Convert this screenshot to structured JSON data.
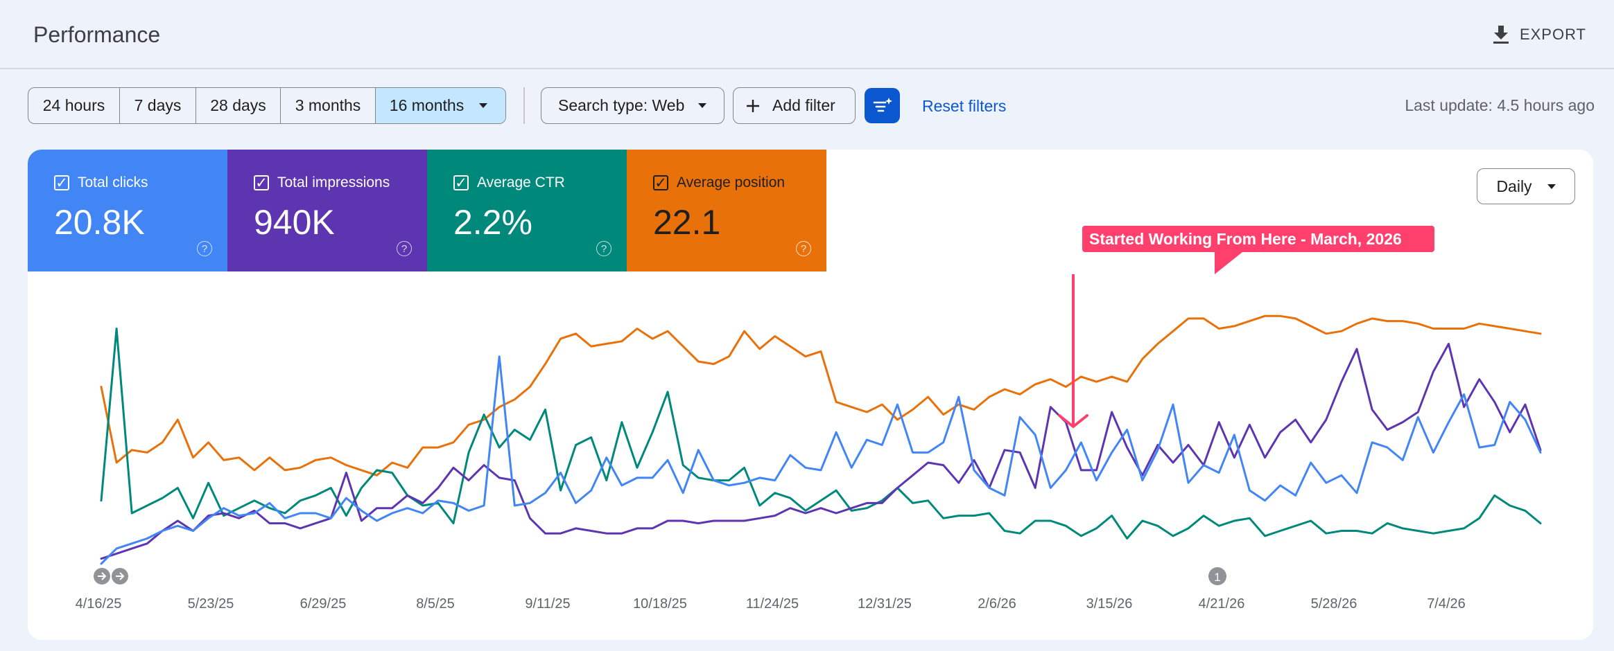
{
  "header": {
    "title": "Performance",
    "export_label": "EXPORT",
    "export_icon": "download-icon"
  },
  "date_range": {
    "options": [
      "24 hours",
      "7 days",
      "28 days",
      "3 months",
      "16 months"
    ],
    "selected": "16 months"
  },
  "filters": {
    "search_type": "Search type: Web",
    "add_filter": "Add filter",
    "reset": "Reset filters",
    "last_update": "Last update: 4.5 hours ago"
  },
  "metrics": [
    {
      "label": "Total clicks",
      "value": "20.8K",
      "color": "#4285f4",
      "text_color": "#ffffff"
    },
    {
      "label": "Total impressions",
      "value": "940K",
      "color": "#5e35b1",
      "text_color": "#ffffff"
    },
    {
      "label": "Average CTR",
      "value": "2.2%",
      "color": "#00897b",
      "text_color": "#ffffff"
    },
    {
      "label": "Average position",
      "value": "22.1",
      "color": "#e8710a",
      "text_color": "#1f1f1f"
    }
  ],
  "granularity": "Daily",
  "annotation": {
    "text": "Started Working From Here - March, 2026",
    "color": "#ff3f6c"
  },
  "markers": {
    "start_icons": [
      "arrow-right-icon",
      "arrow-right-icon"
    ],
    "note_badge": "1"
  },
  "chart_data": {
    "type": "line",
    "x_tick_labels": [
      "4/16/25",
      "5/23/25",
      "6/29/25",
      "8/5/25",
      "9/11/25",
      "10/18/25",
      "11/24/25",
      "12/31/25",
      "2/6/26",
      "3/15/26",
      "4/21/26",
      "5/28/26",
      "7/4/26"
    ],
    "x_range": [
      "4/16/25",
      "8/1/26"
    ],
    "y_axis": "hidden (each series independently scaled, 0–1 normalized)",
    "grid": false,
    "series": [
      {
        "name": "Total clicks",
        "color": "#4285f4",
        "values": [
          0.0,
          0.06,
          0.08,
          0.1,
          0.13,
          0.15,
          0.13,
          0.18,
          0.22,
          0.19,
          0.2,
          0.24,
          0.18,
          0.2,
          0.2,
          0.18,
          0.26,
          0.21,
          0.17,
          0.2,
          0.22,
          0.2,
          0.25,
          0.24,
          0.21,
          0.23,
          0.82,
          0.23,
          0.24,
          0.28,
          0.36,
          0.24,
          0.29,
          0.42,
          0.31,
          0.34,
          0.34,
          0.41,
          0.28,
          0.45,
          0.33,
          0.31,
          0.32,
          0.34,
          0.33,
          0.43,
          0.38,
          0.37,
          0.52,
          0.38,
          0.49,
          0.47,
          0.63,
          0.44,
          0.44,
          0.48,
          0.66,
          0.37,
          0.3,
          0.27,
          0.58,
          0.51,
          0.3,
          0.37,
          0.48,
          0.33,
          0.44,
          0.53,
          0.33,
          0.45,
          0.63,
          0.32,
          0.39,
          0.36,
          0.51,
          0.29,
          0.25,
          0.31,
          0.27,
          0.4,
          0.32,
          0.35,
          0.28,
          0.48,
          0.46,
          0.41,
          0.58,
          0.44,
          0.56,
          0.67,
          0.46,
          0.47,
          0.64,
          0.57,
          0.44
        ]
      },
      {
        "name": "Total impressions",
        "color": "#5e35b1",
        "values": [
          0.02,
          0.04,
          0.06,
          0.08,
          0.13,
          0.17,
          0.13,
          0.19,
          0.2,
          0.18,
          0.21,
          0.16,
          0.16,
          0.14,
          0.16,
          0.18,
          0.36,
          0.17,
          0.22,
          0.22,
          0.27,
          0.24,
          0.3,
          0.38,
          0.33,
          0.39,
          0.34,
          0.33,
          0.18,
          0.12,
          0.12,
          0.14,
          0.13,
          0.12,
          0.12,
          0.14,
          0.14,
          0.17,
          0.17,
          0.16,
          0.17,
          0.17,
          0.17,
          0.18,
          0.19,
          0.22,
          0.2,
          0.22,
          0.2,
          0.22,
          0.24,
          0.24,
          0.3,
          0.35,
          0.4,
          0.39,
          0.32,
          0.41,
          0.3,
          0.45,
          0.44,
          0.3,
          0.62,
          0.56,
          0.37,
          0.37,
          0.6,
          0.46,
          0.35,
          0.47,
          0.4,
          0.47,
          0.39,
          0.56,
          0.42,
          0.55,
          0.42,
          0.52,
          0.57,
          0.48,
          0.57,
          0.72,
          0.85,
          0.61,
          0.53,
          0.56,
          0.6,
          0.76,
          0.87,
          0.62,
          0.73,
          0.64,
          0.52,
          0.63,
          0.45
        ]
      },
      {
        "name": "Average CTR",
        "color": "#00897b",
        "values": [
          0.25,
          0.93,
          0.2,
          0.23,
          0.26,
          0.3,
          0.18,
          0.32,
          0.19,
          0.22,
          0.25,
          0.22,
          0.2,
          0.25,
          0.27,
          0.3,
          0.19,
          0.3,
          0.37,
          0.36,
          0.27,
          0.23,
          0.24,
          0.16,
          0.44,
          0.59,
          0.46,
          0.53,
          0.49,
          0.61,
          0.29,
          0.47,
          0.5,
          0.33,
          0.56,
          0.38,
          0.52,
          0.68,
          0.39,
          0.34,
          0.33,
          0.33,
          0.38,
          0.23,
          0.28,
          0.26,
          0.21,
          0.25,
          0.29,
          0.21,
          0.22,
          0.25,
          0.3,
          0.24,
          0.25,
          0.18,
          0.19,
          0.19,
          0.2,
          0.13,
          0.12,
          0.17,
          0.17,
          0.15,
          0.11,
          0.14,
          0.19,
          0.1,
          0.17,
          0.15,
          0.11,
          0.14,
          0.19,
          0.15,
          0.17,
          0.18,
          0.11,
          0.13,
          0.15,
          0.17,
          0.12,
          0.13,
          0.13,
          0.12,
          0.16,
          0.14,
          0.13,
          0.12,
          0.13,
          0.14,
          0.18,
          0.27,
          0.23,
          0.21,
          0.16
        ]
      },
      {
        "name": "Average position",
        "color": "#e8710a",
        "values": [
          0.7,
          0.4,
          0.45,
          0.44,
          0.48,
          0.57,
          0.42,
          0.48,
          0.41,
          0.42,
          0.37,
          0.42,
          0.37,
          0.38,
          0.41,
          0.42,
          0.39,
          0.37,
          0.35,
          0.4,
          0.38,
          0.46,
          0.46,
          0.48,
          0.55,
          0.57,
          0.62,
          0.65,
          0.7,
          0.79,
          0.89,
          0.91,
          0.86,
          0.87,
          0.88,
          0.93,
          0.89,
          0.92,
          0.86,
          0.8,
          0.79,
          0.82,
          0.92,
          0.85,
          0.9,
          0.86,
          0.82,
          0.84,
          0.64,
          0.62,
          0.6,
          0.63,
          0.57,
          0.61,
          0.66,
          0.59,
          0.63,
          0.61,
          0.66,
          0.69,
          0.67,
          0.71,
          0.73,
          0.7,
          0.74,
          0.72,
          0.74,
          0.72,
          0.81,
          0.87,
          0.92,
          0.97,
          0.97,
          0.93,
          0.94,
          0.96,
          0.98,
          0.98,
          0.97,
          0.94,
          0.91,
          0.92,
          0.95,
          0.97,
          0.96,
          0.96,
          0.95,
          0.93,
          0.93,
          0.93,
          0.95,
          0.94,
          0.93,
          0.92,
          0.91
        ]
      }
    ]
  }
}
